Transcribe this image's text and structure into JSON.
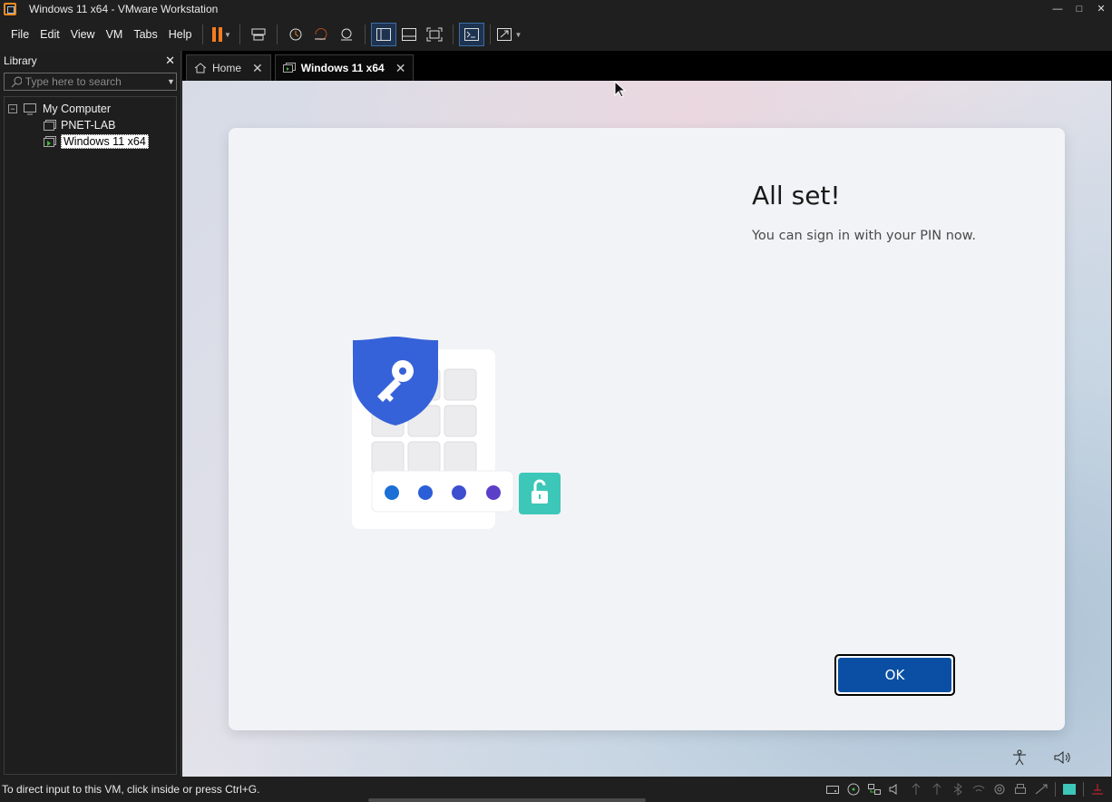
{
  "window": {
    "title": "Windows 11 x64 - VMware Workstation",
    "controls": [
      "minimize",
      "maximize",
      "close"
    ]
  },
  "menubar": {
    "items": [
      "File",
      "Edit",
      "View",
      "VM",
      "Tabs",
      "Help"
    ]
  },
  "toolbar": {
    "buttons": [
      "pause-icon",
      "send-ctrl-alt-del-icon",
      "snapshot-take-icon",
      "snapshot-revert-icon",
      "snapshot-manager-icon",
      "library-view-icon",
      "thumbnail-bar-icon",
      "full-screen-icon",
      "console-view-icon",
      "stretch-guest-icon"
    ]
  },
  "library": {
    "title": "Library",
    "search_placeholder": "Type here to search",
    "tree": {
      "root": "My Computer",
      "children": [
        "PNET-LAB",
        "Windows 11 x64"
      ],
      "selected": "Windows 11 x64"
    }
  },
  "tabs": [
    {
      "label": "Home",
      "active": false
    },
    {
      "label": "Windows 11 x64",
      "active": true
    }
  ],
  "guest": {
    "title": "All set!",
    "subtitle": "You can sign in with your PIN now.",
    "ok_label": "OK",
    "accent": "#0a4fa3"
  },
  "statusbar": {
    "hint": "To direct input to this VM, click inside or press Ctrl+G."
  }
}
